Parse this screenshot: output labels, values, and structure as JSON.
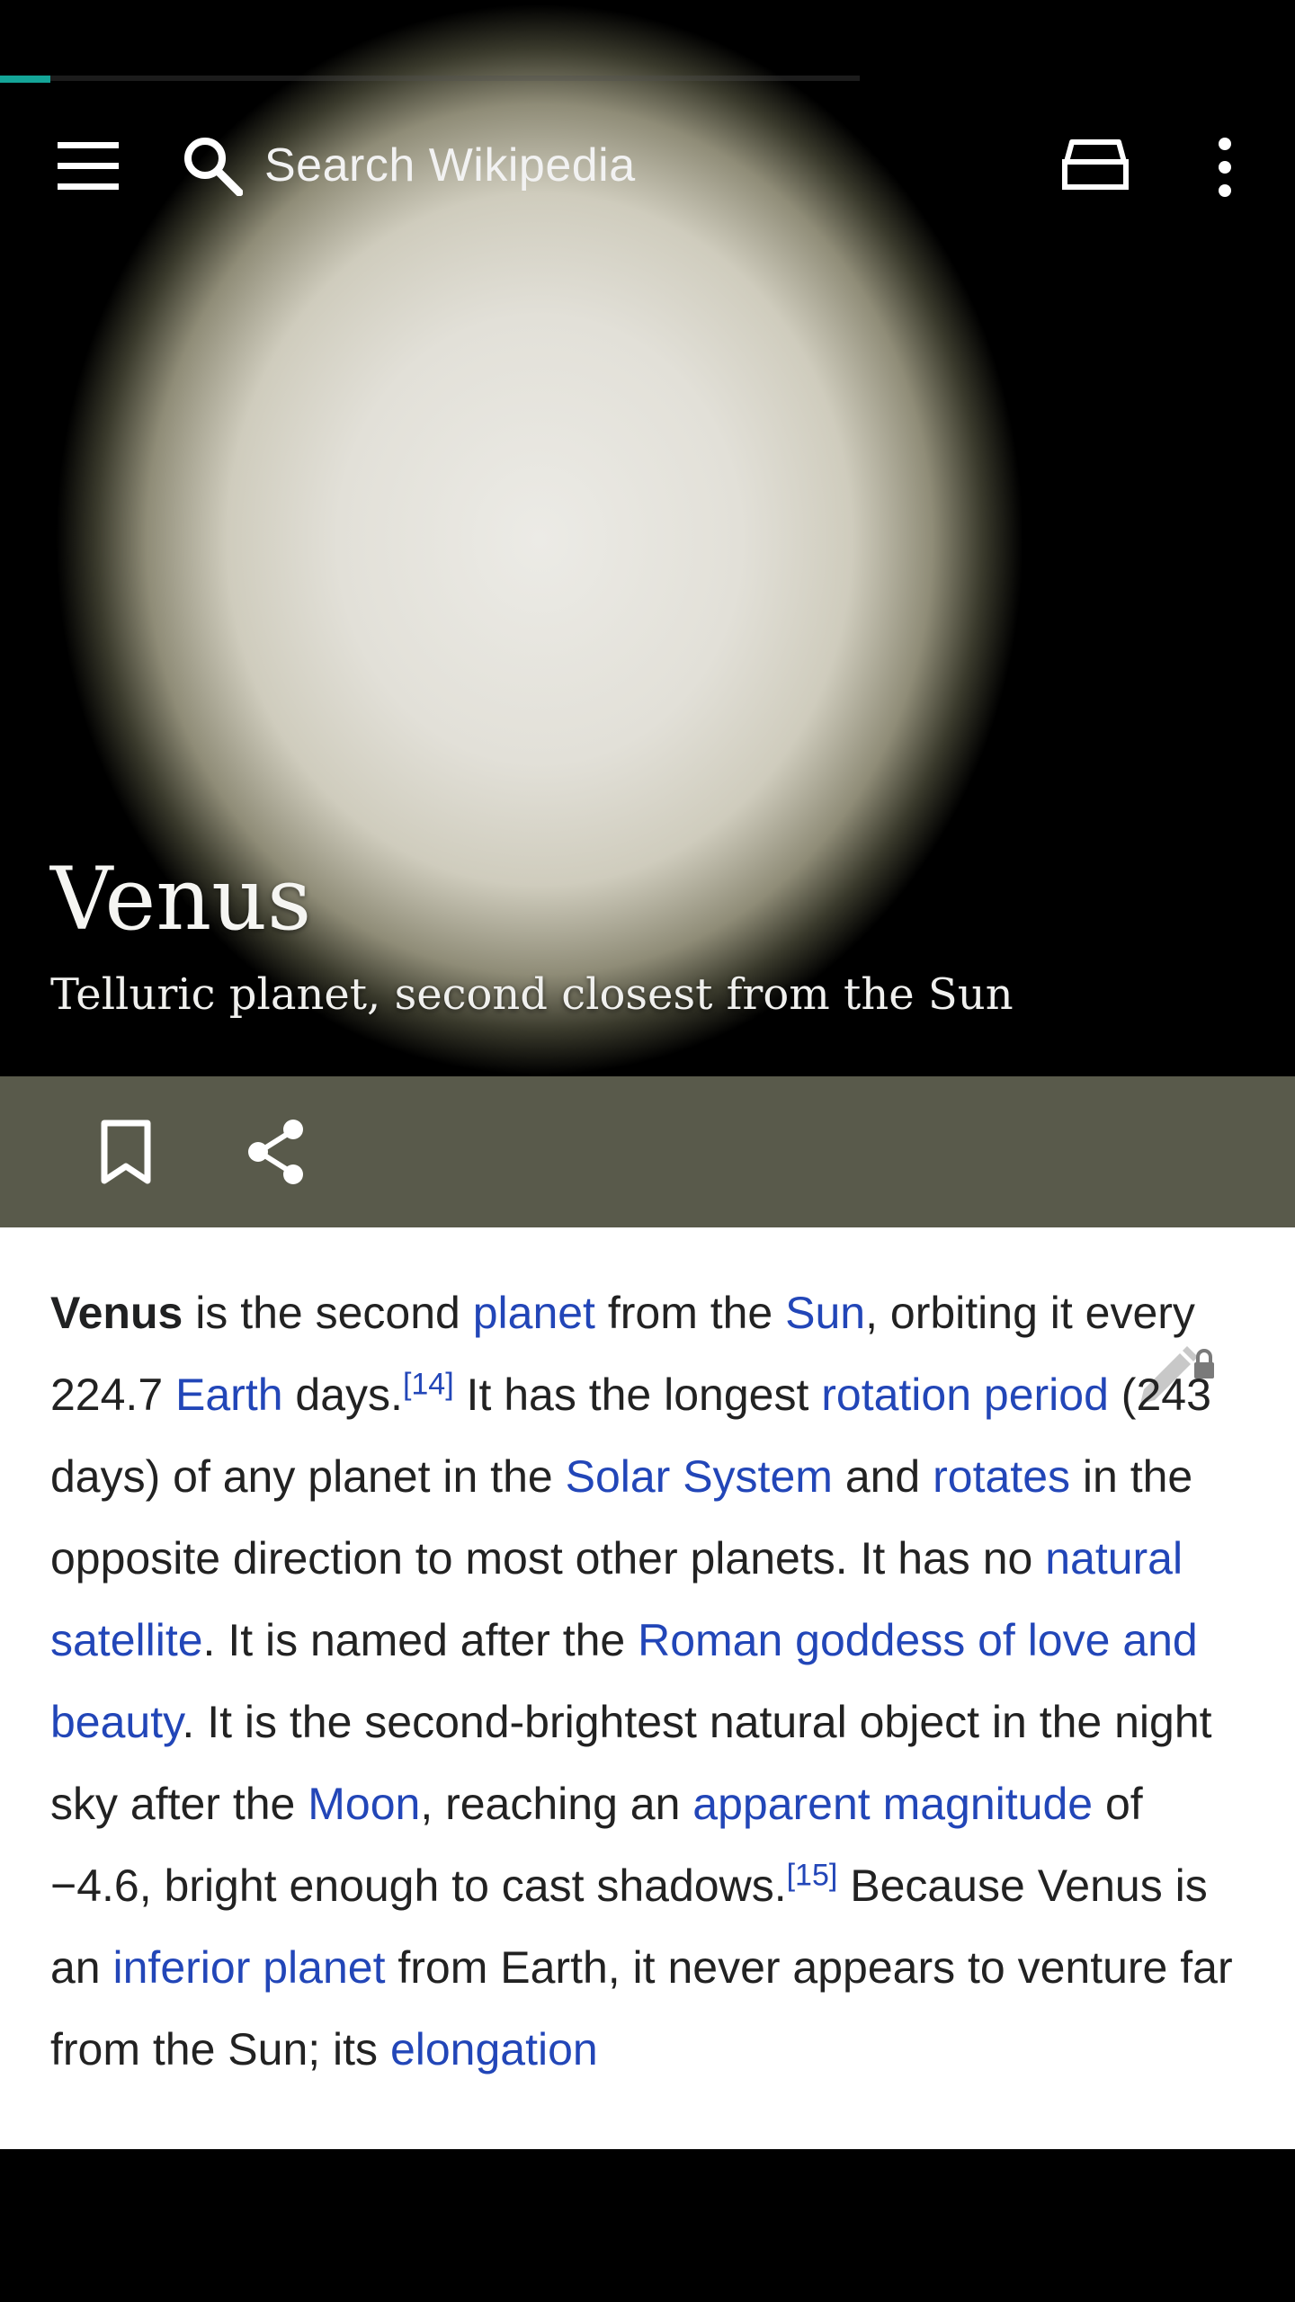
{
  "toolbar": {
    "search_placeholder": "Search Wikipedia",
    "icons": [
      "menu-icon",
      "search-icon",
      "tabs-icon",
      "more-vert-icon"
    ]
  },
  "article": {
    "title": "Venus",
    "description": "Telluric planet, second closest from the Sun"
  },
  "actions": {
    "icons": [
      "bookmark-icon",
      "share-icon"
    ]
  },
  "colors": {
    "accent": "#14a598",
    "link": "#2246b8",
    "action_bar": "#595a4b",
    "text": "#222222"
  },
  "body": {
    "s1": "Venus",
    "s2": " is the second ",
    "l_planet": "planet",
    "s3": " from the ",
    "l_sun": "Sun",
    "s4": ", orbiting it every 224.7 ",
    "l_earth": "Earth",
    "s5": " days.",
    "ref14": "[14]",
    "s6": " It has the longest ",
    "l_rotation": "rotation period",
    "s7": " (243 days) of any planet in the ",
    "l_solar": "Solar System",
    "s8": " and ",
    "l_rotates": "rotates",
    "s9": " in the opposite direction to most other planets. It has no ",
    "l_satellite": "natural satellite",
    "s10": ". It is named after the ",
    "l_roman": "Roman goddess of love and beauty",
    "s11": ". It is the second-brightest natural object in the night sky after the ",
    "l_moon": "Moon",
    "s12": ", reaching an ",
    "l_magnitude": "apparent magnitude",
    "s13": " of −4.6, bright enough to cast shadows.",
    "ref15": "[15]",
    "s14": " Because Venus is an ",
    "l_inferior": "inferior planet",
    "s15": " from Earth, it never appears to venture far from the Sun; its ",
    "l_elongation": "elongation"
  }
}
